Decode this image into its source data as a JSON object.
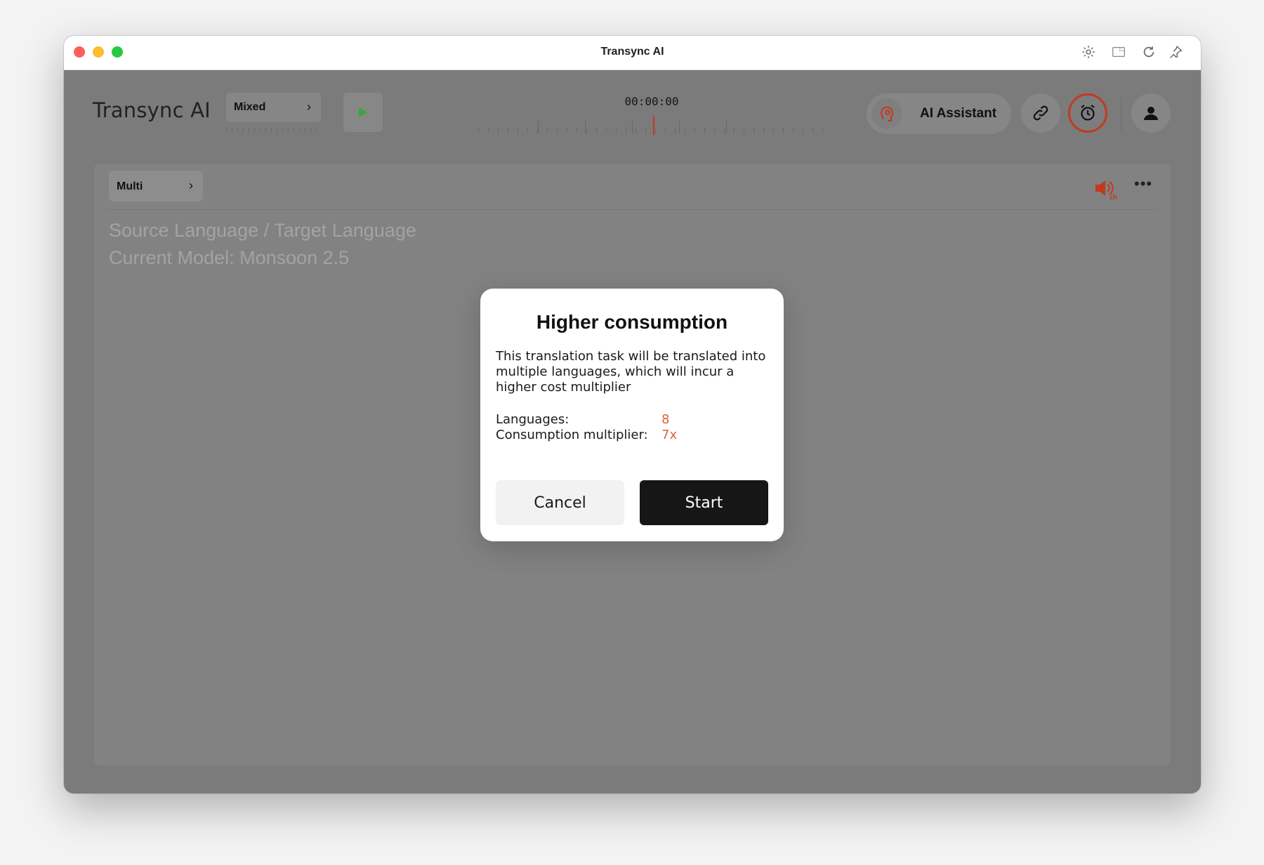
{
  "window": {
    "title": "Transync AI"
  },
  "header": {
    "brand": "Transync AI",
    "mode_label": "Mixed",
    "timer": "00:00:00",
    "assistant_label": "AI Assistant"
  },
  "panel": {
    "language_selector": "Multi",
    "speaker_badge": "zh",
    "meta_line_1": "Source Language / Target Language",
    "meta_line_2": "Current Model: Monsoon 2.5"
  },
  "modal": {
    "title": "Higher consumption",
    "body": "This translation task will be translated into multiple languages, which will incur a higher cost multiplier",
    "languages_label": "Languages:",
    "languages_value": "8",
    "multiplier_label": "Consumption multiplier:",
    "multiplier_value": "7x",
    "cancel_label": "Cancel",
    "start_label": "Start"
  },
  "colors": {
    "accent": "#e2603c",
    "alarm_ring": "#c23a1e",
    "play_green": "#3aa53a",
    "start_button": "#161616"
  },
  "icons": [
    "settings-icon",
    "window-icon",
    "refresh-icon",
    "pin-icon",
    "play-icon",
    "brain-icon",
    "link-icon",
    "alarm-icon",
    "user-icon",
    "speaker-icon",
    "more-icon",
    "chevron-right-icon"
  ]
}
